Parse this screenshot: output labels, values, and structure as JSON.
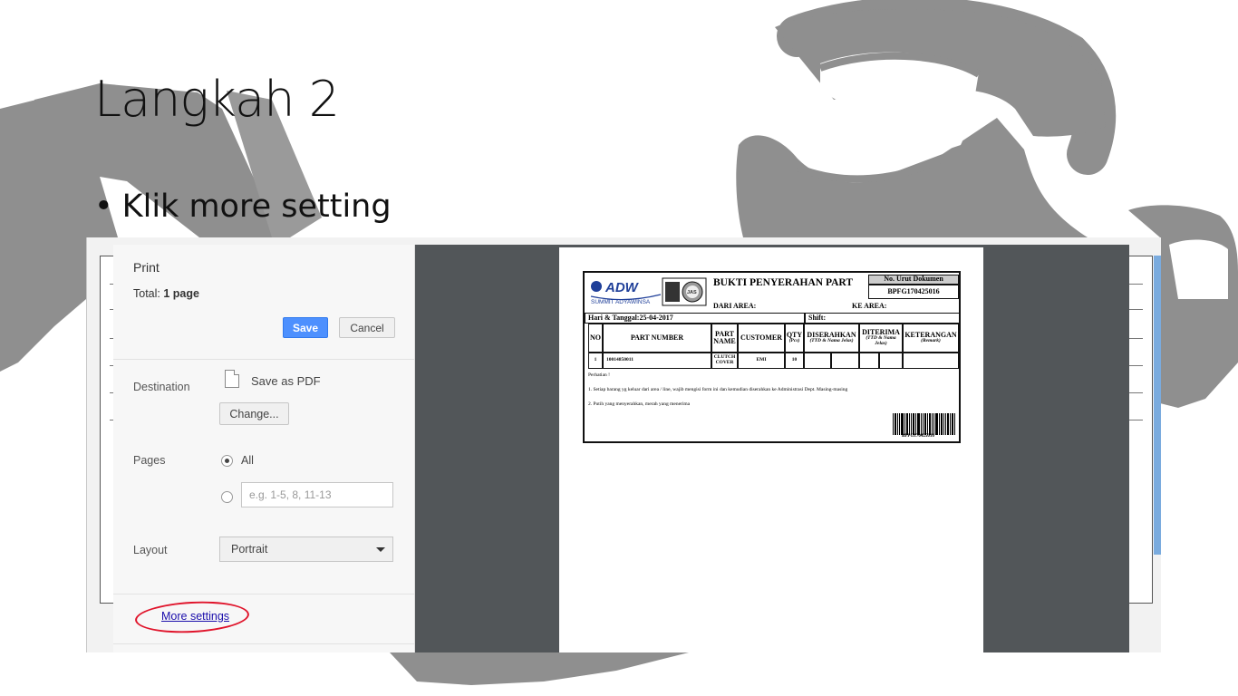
{
  "slide": {
    "title": "Langkah 2",
    "bullet": "Klik more setting"
  },
  "print_panel": {
    "title": "Print",
    "total_label": "Total:",
    "total_value": "1 page",
    "save_label": "Save",
    "cancel_label": "Cancel",
    "destination_label": "Destination",
    "destination_value": "Save as PDF",
    "change_label": "Change...",
    "pages_label": "Pages",
    "pages_all_label": "All",
    "pages_range_placeholder": "e.g. 1-5, 8, 11-13",
    "layout_label": "Layout",
    "layout_value": "Portrait",
    "more_settings_label": "More settings"
  },
  "preview_form": {
    "logo_text": "ADW",
    "logo_subtext": "SUMMIT ADYAWINSA",
    "cert_text": "JAS",
    "title": "BUKTI PENYERAHAN PART",
    "doc_no_label": "No. Urut Dokumen",
    "doc_no_value": "BPFG170425016",
    "dari_area": "DARI AREA:",
    "ke_area": "KE AREA:",
    "hari_tanggal": "Hari & Tanggal:25-04-2017",
    "shift": "Shift:",
    "headers": {
      "no": "NO",
      "part_number": "PART NUMBER",
      "part_name": "PART NAME",
      "customer": "CUSTOMER",
      "qty": "QTY",
      "qty_unit": "(Pcs)",
      "diserahkan": "DISERAHKAN",
      "diserahkan_sub": "(TTD & Nama Jelas)",
      "diterima": "DITERIMA",
      "diterima_sub": "(TTD & Nama Jelas)",
      "keterangan": "KETERANGAN",
      "keterangan_sub": "(Remark)"
    },
    "row": {
      "no": "1",
      "part_number": "10014850011",
      "part_name": "CLUTCH COVER",
      "customer": "EMI",
      "qty": "10"
    },
    "notes_title": "Perhatian !",
    "note_1": "1. Setiap barang yg keluar dari area / line, wajib mengisi form ini dan kemudian diserahkan ke Administrasi Dept. Masing-masing",
    "note_2": "2. Putih yang menyerahkan, merah yang menerima",
    "barcode_text": "BPFG170425016"
  },
  "colors": {
    "save_button": "#4d90fe",
    "link": "#1a0dab",
    "highlight_circle": "#e0142b",
    "preview_bg": "#525659",
    "decoration": "#8f8f8f"
  }
}
